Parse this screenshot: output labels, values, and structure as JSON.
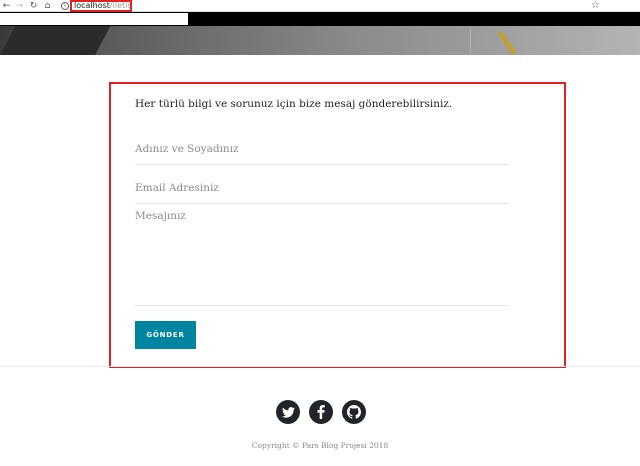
{
  "browser": {
    "url_host": "localhost",
    "url_path": "/iletisim",
    "icons": {
      "back": "arrow-left-icon",
      "forward": "arrow-right-icon",
      "reload": "reload-icon",
      "home": "home-icon",
      "info": "info-icon",
      "bookmark": "star-icon"
    }
  },
  "contact": {
    "intro": "Her türlü bilgi ve sorunuz için bize mesaj gönderebilirsiniz.",
    "name_placeholder": "Adınız ve Soyadınız",
    "email_placeholder": "Email Adresiniz",
    "message_placeholder": "Mesajınız",
    "send_label": "GÖNDER",
    "accent_color": "#0085a1",
    "highlight_color": "#e2201f"
  },
  "footer": {
    "social": [
      "twitter-icon",
      "facebook-icon",
      "github-icon"
    ],
    "copyright": "Copyright © Pars Blog Projesi 2018"
  }
}
